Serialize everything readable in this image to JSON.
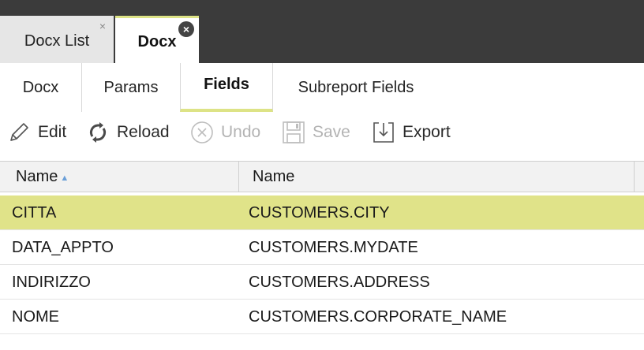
{
  "window_tabs": [
    {
      "label": "Docx List",
      "close": "×"
    },
    {
      "label": "Docx",
      "close": "×"
    }
  ],
  "sub_tabs": [
    {
      "label": "Docx"
    },
    {
      "label": "Params"
    },
    {
      "label": "Fields"
    },
    {
      "label": "Subreport Fields"
    }
  ],
  "toolbar": {
    "edit": "Edit",
    "reload": "Reload",
    "undo": "Undo",
    "save": "Save",
    "export": "Export"
  },
  "grid": {
    "columns": [
      "Name",
      "Name"
    ],
    "sort_indicator": "▲",
    "rows": [
      {
        "name": "CITTA",
        "field": "CUSTOMERS.CITY"
      },
      {
        "name": "DATA_APPTO",
        "field": "CUSTOMERS.MYDATE"
      },
      {
        "name": "INDIRIZZO",
        "field": "CUSTOMERS.ADDRESS"
      },
      {
        "name": "NOME",
        "field": "CUSTOMERS.CORPORATE_NAME"
      }
    ]
  }
}
